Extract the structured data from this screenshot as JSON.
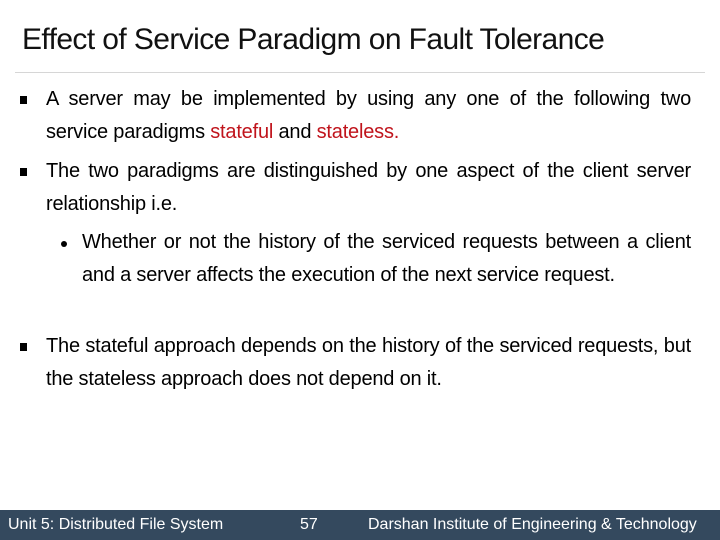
{
  "slide": {
    "title": "Effect of Service Paradigm on Fault Tolerance",
    "bullets": [
      {
        "level": 1,
        "marker": "square-bullet",
        "segments": [
          {
            "text": "A server may be implemented by using any one of the following two service paradigms ",
            "accent": false
          },
          {
            "text": "stateful",
            "accent": true
          },
          {
            "text": " and ",
            "accent": false
          },
          {
            "text": "stateless.",
            "accent": true
          }
        ]
      },
      {
        "level": 1,
        "marker": "square-bullet",
        "text": "The two paradigms are distinguished by one aspect of the client server relationship i.e."
      },
      {
        "level": 2,
        "marker": "round-bullet",
        "text": "Whether or not the history of the serviced requests between a client and a server affects the execution of the next service request."
      },
      {
        "level": 1,
        "marker": "square-bullet",
        "text": "The stateful approach depends on the history of the serviced requests, but the stateless approach does not depend on it."
      }
    ],
    "accent_color": "#c0141c"
  },
  "footer": {
    "unit": "Unit 5: Distributed File System",
    "page_number": "57",
    "institute": "Darshan Institute of Engineering & Technology",
    "background_color": "#34495e"
  }
}
